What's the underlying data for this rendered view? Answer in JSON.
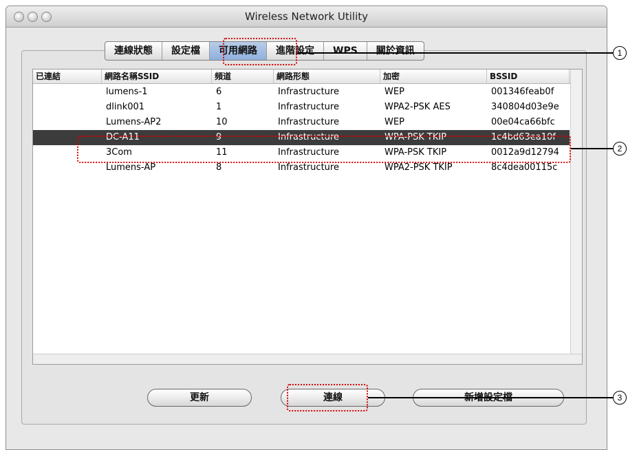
{
  "window": {
    "title": "Wireless Network Utility"
  },
  "tabs": [
    {
      "label": "連線狀態"
    },
    {
      "label": "設定檔"
    },
    {
      "label": "可用網路"
    },
    {
      "label": "進階設定"
    },
    {
      "label": "WPS"
    },
    {
      "label": "關於資訊"
    }
  ],
  "table": {
    "columns": [
      "已連結",
      "網路名稱SSID",
      "頻道",
      "網路形態",
      "加密",
      "BSSID"
    ],
    "rows": [
      {
        "connected": "",
        "ssid": "lumens-1",
        "channel": "6",
        "type": "Infrastructure",
        "encryption": "WEP",
        "bssid": "001346feab0f"
      },
      {
        "connected": "",
        "ssid": "dlink001",
        "channel": "1",
        "type": "Infrastructure",
        "encryption": "WPA2-PSK AES",
        "bssid": "340804d03e9e"
      },
      {
        "connected": "",
        "ssid": "Lumens-AP2",
        "channel": "10",
        "type": "Infrastructure",
        "encryption": "WEP",
        "bssid": "00e04ca66bfc"
      },
      {
        "connected": "",
        "ssid": "DC-A11",
        "channel": "9",
        "type": "Infrastructure",
        "encryption": "WPA-PSK TKIP",
        "bssid": "1c4bd63ea10f",
        "selected": true
      },
      {
        "connected": "",
        "ssid": "3Com",
        "channel": "11",
        "type": "Infrastructure",
        "encryption": "WPA-PSK TKIP",
        "bssid": "0012a9d12794"
      },
      {
        "connected": "",
        "ssid": "Lumens-AP",
        "channel": "8",
        "type": "Infrastructure",
        "encryption": "WPA2-PSK TKIP",
        "bssid": "8c4dea00115c"
      }
    ]
  },
  "buttons": {
    "refresh": "更新",
    "connect": "連線",
    "add_profile": "新增設定檔"
  },
  "callouts": [
    "1",
    "2",
    "3"
  ],
  "colors": {
    "highlight": "#d80000",
    "selected_row": "#3c3c3c",
    "selected_tab": "#9fbbe2"
  }
}
